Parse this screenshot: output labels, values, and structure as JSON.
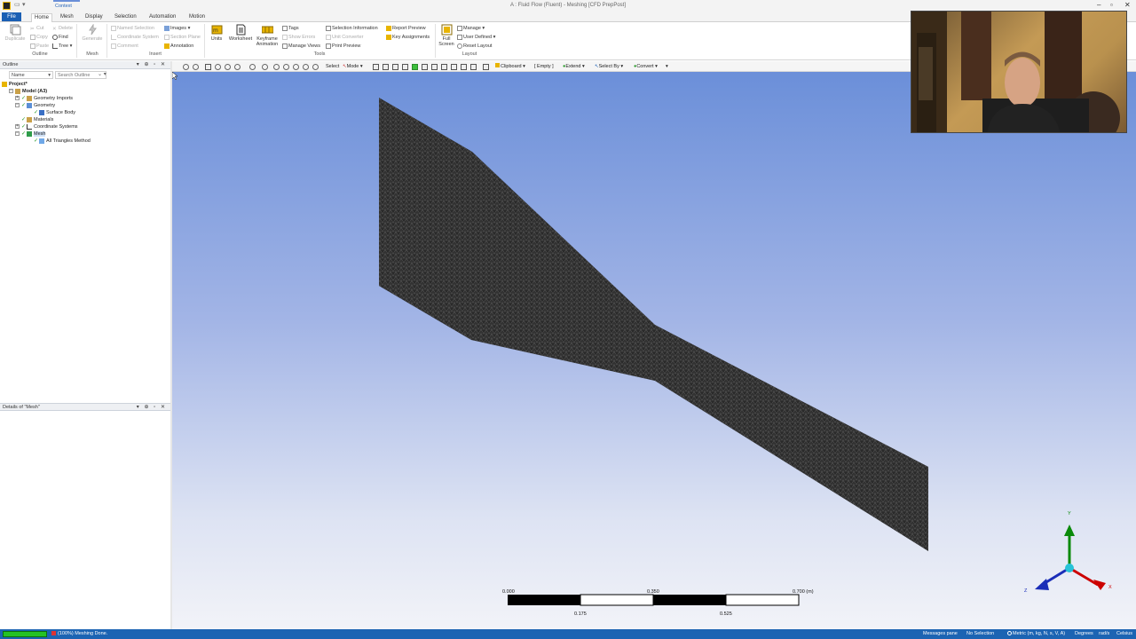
{
  "window": {
    "title": "A : Fluid Flow (Fluent) - Meshing [CFD PrepPost]",
    "context_label": "Context"
  },
  "tabs": [
    {
      "label": "File"
    },
    {
      "label": "Home"
    },
    {
      "label": "Mesh"
    },
    {
      "label": "Display"
    },
    {
      "label": "Selection"
    },
    {
      "label": "Automation"
    },
    {
      "label": "Motion"
    }
  ],
  "ribbon": {
    "outline": {
      "duplicate": "Duplicate",
      "cut": "Cut",
      "copy": "Copy",
      "paste": "Paste",
      "delete": "Delete",
      "find": "Find",
      "tree": "Tree",
      "label": "Outline"
    },
    "mesh": {
      "button": "Generate",
      "label": "Mesh"
    },
    "insert": {
      "named_selection": "Named Selection",
      "coordinate_system": "Coordinate System",
      "comment": "Comment",
      "images": "Images",
      "section_plane": "Section Plane",
      "annotation": "Annotation",
      "label": "Insert"
    },
    "tools": {
      "units": "Units",
      "worksheet": "Worksheet",
      "keyframe_1": "Keyframe",
      "keyframe_2": "Animation",
      "tags": "Tags",
      "show_errors": "Show Errors",
      "manage_views": "Manage Views",
      "selection_information": "Selection Information",
      "unit_converter": "Unit Converter",
      "print_preview": "Print Preview",
      "report_preview": "Report Preview",
      "key_assignments": "Key Assignments",
      "label": "Tools"
    },
    "layout": {
      "full_1": "Full",
      "full_2": "Screen",
      "manage": "Manage",
      "user_defined": "User Defined",
      "reset_layout": "Reset Layout",
      "label": "Layout"
    }
  },
  "outline": {
    "title": "Outline",
    "filter_name": "Name",
    "search_placeholder": "Search Outline",
    "tree": [
      {
        "label": "Project*"
      },
      {
        "label": "Model (A3)"
      },
      {
        "label": "Geometry Imports"
      },
      {
        "label": "Geometry"
      },
      {
        "label": "Surface Body"
      },
      {
        "label": "Materials"
      },
      {
        "label": "Coordinate Systems"
      },
      {
        "label": "Mesh"
      },
      {
        "label": "All Triangles Method"
      }
    ]
  },
  "details": {
    "title": "Details of \"Mesh\""
  },
  "graphics_toolbar": {
    "select": "Select",
    "mode": "Mode",
    "clipboard": "Clipboard",
    "empty": "[ Empty ]",
    "extend": "Extend",
    "select_by": "Select By",
    "convert": "Convert"
  },
  "scale_bar": {
    "top_labels": [
      "0.000",
      "0.350",
      "0.700 (m)"
    ],
    "bottom_labels": [
      "0.175",
      "0.525"
    ]
  },
  "triad": {
    "x": "X",
    "y": "Y",
    "z": "Z"
  },
  "status": {
    "progress": 1.0,
    "meshing": "(100%) Meshing Done.",
    "messages": "Messages pane",
    "selection": "No Selection",
    "units": "Metric (m, kg, N, s, V, A)",
    "angle": "Degrees",
    "angular_velocity": "rad/s",
    "temperature": "Celsius"
  },
  "colors": {
    "accent": "#1c64b3",
    "mesh": "#2a2a2a",
    "viewport_top": "#6b8fd9",
    "viewport_bottom": "#f2f3f8"
  }
}
